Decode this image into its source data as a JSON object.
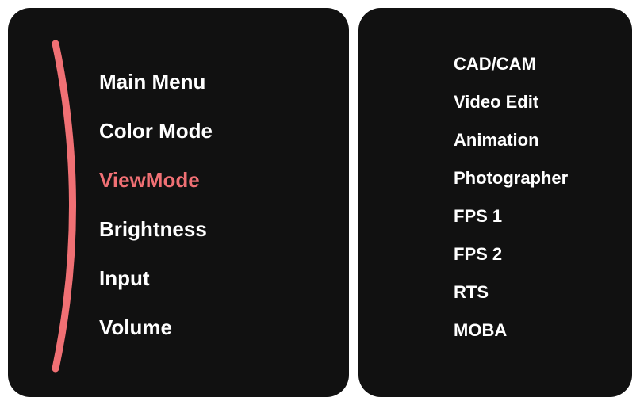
{
  "main_menu": {
    "items": [
      {
        "label": "Main Menu",
        "selected": false
      },
      {
        "label": "Color Mode",
        "selected": false
      },
      {
        "label": "ViewMode",
        "selected": true
      },
      {
        "label": "Brightness",
        "selected": false
      },
      {
        "label": "Input",
        "selected": false
      },
      {
        "label": "Volume",
        "selected": false
      }
    ]
  },
  "submenu": {
    "items": [
      {
        "label": "CAD/CAM"
      },
      {
        "label": "Video Edit"
      },
      {
        "label": "Animation"
      },
      {
        "label": "Photographer"
      },
      {
        "label": "FPS 1"
      },
      {
        "label": "FPS 2"
      },
      {
        "label": "RTS"
      },
      {
        "label": "MOBA"
      }
    ]
  },
  "accent_color": "#f07074"
}
